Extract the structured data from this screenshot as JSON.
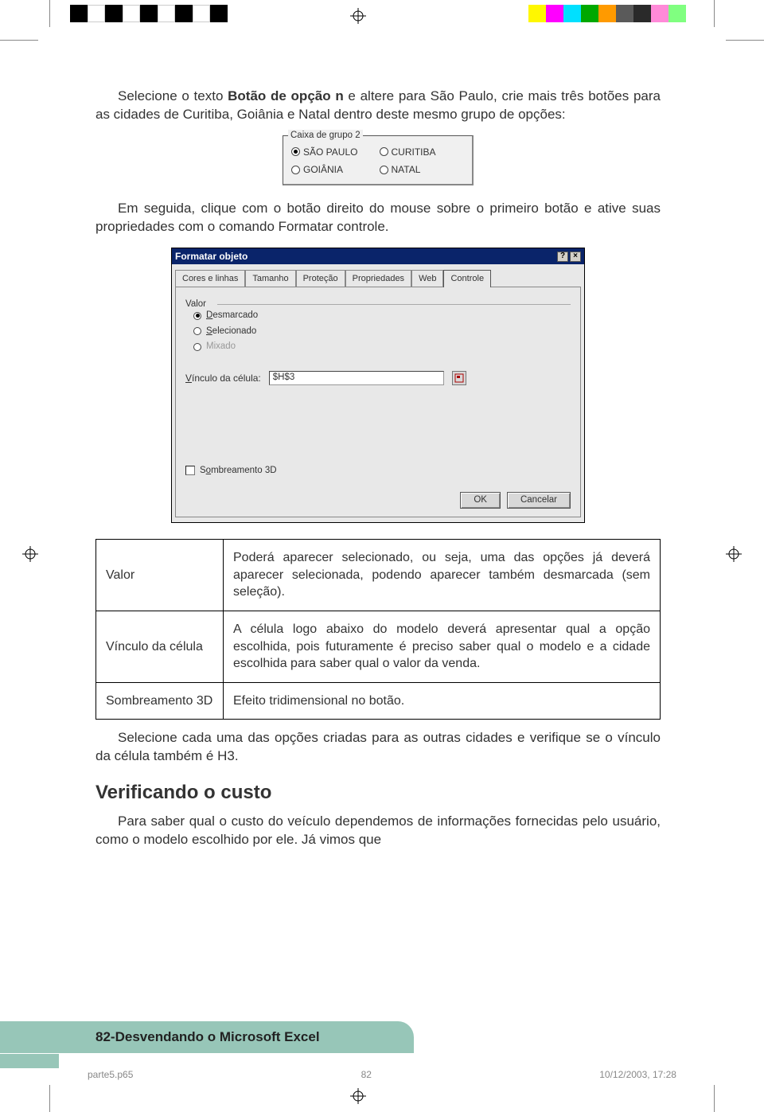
{
  "paragraphs": {
    "p1a": "Selecione o texto ",
    "p1b": "Botão de opção n",
    "p1c": " e altere para São Paulo, crie mais três botões para as cidades de Curitiba, Goiânia e Natal dentro deste mesmo grupo de opções:",
    "p2": "Em seguida, clique com o botão direito do mouse sobre o primeiro botão e ative suas propriedades com o comando Formatar controle.",
    "p3": "Selecione cada uma das opções criadas para as outras cidades e verifique se o vínculo da célula também é H3.",
    "p4": "Para saber qual o custo do veículo dependemos de informações fornecidas pelo usuário, como o modelo escolhido por ele. Já vimos que"
  },
  "groupbox": {
    "legend": "Caixa de grupo 2",
    "options": [
      "SÃO PAULO",
      "CURITIBA",
      "GOIÂNIA",
      "NATAL"
    ],
    "selected": 0
  },
  "dialog": {
    "title": "Formatar objeto",
    "tabs": [
      "Cores e linhas",
      "Tamanho",
      "Proteção",
      "Propriedades",
      "Web",
      "Controle"
    ],
    "active_tab": 5,
    "valor_label": "Valor",
    "valor_options": [
      "Desmarcado",
      "Selecionado",
      "Mixado"
    ],
    "valor_selected": 0,
    "vinculo_label": "Vínculo da célula:",
    "vinculo_value": "$H$3",
    "sombreamento_label": "Sombreamento 3D",
    "ok": "OK",
    "cancel": "Cancelar"
  },
  "deftable": {
    "rows": [
      {
        "term": "Valor",
        "desc": "Poderá aparecer selecionado, ou seja, uma das opções já deverá aparecer selecionada, podendo aparecer também desmarcada (sem seleção)."
      },
      {
        "term": "Vínculo da célula",
        "desc": "A célula logo abaixo do modelo deverá apresentar qual a opção escolhida, pois futuramente é preciso saber qual o modelo e a cidade escolhida para saber qual o valor da venda."
      },
      {
        "term": "Sombreamento 3D",
        "desc": "Efeito tridimensional no botão."
      }
    ]
  },
  "heading": "Verificando o custo",
  "footer_band": {
    "page": "82",
    "sep": " - ",
    "title": "Desvendando o Microsoft Excel"
  },
  "docfooter": {
    "file": "parte5.p65",
    "page": "82",
    "datetime": "10/12/2003, 17:28"
  }
}
